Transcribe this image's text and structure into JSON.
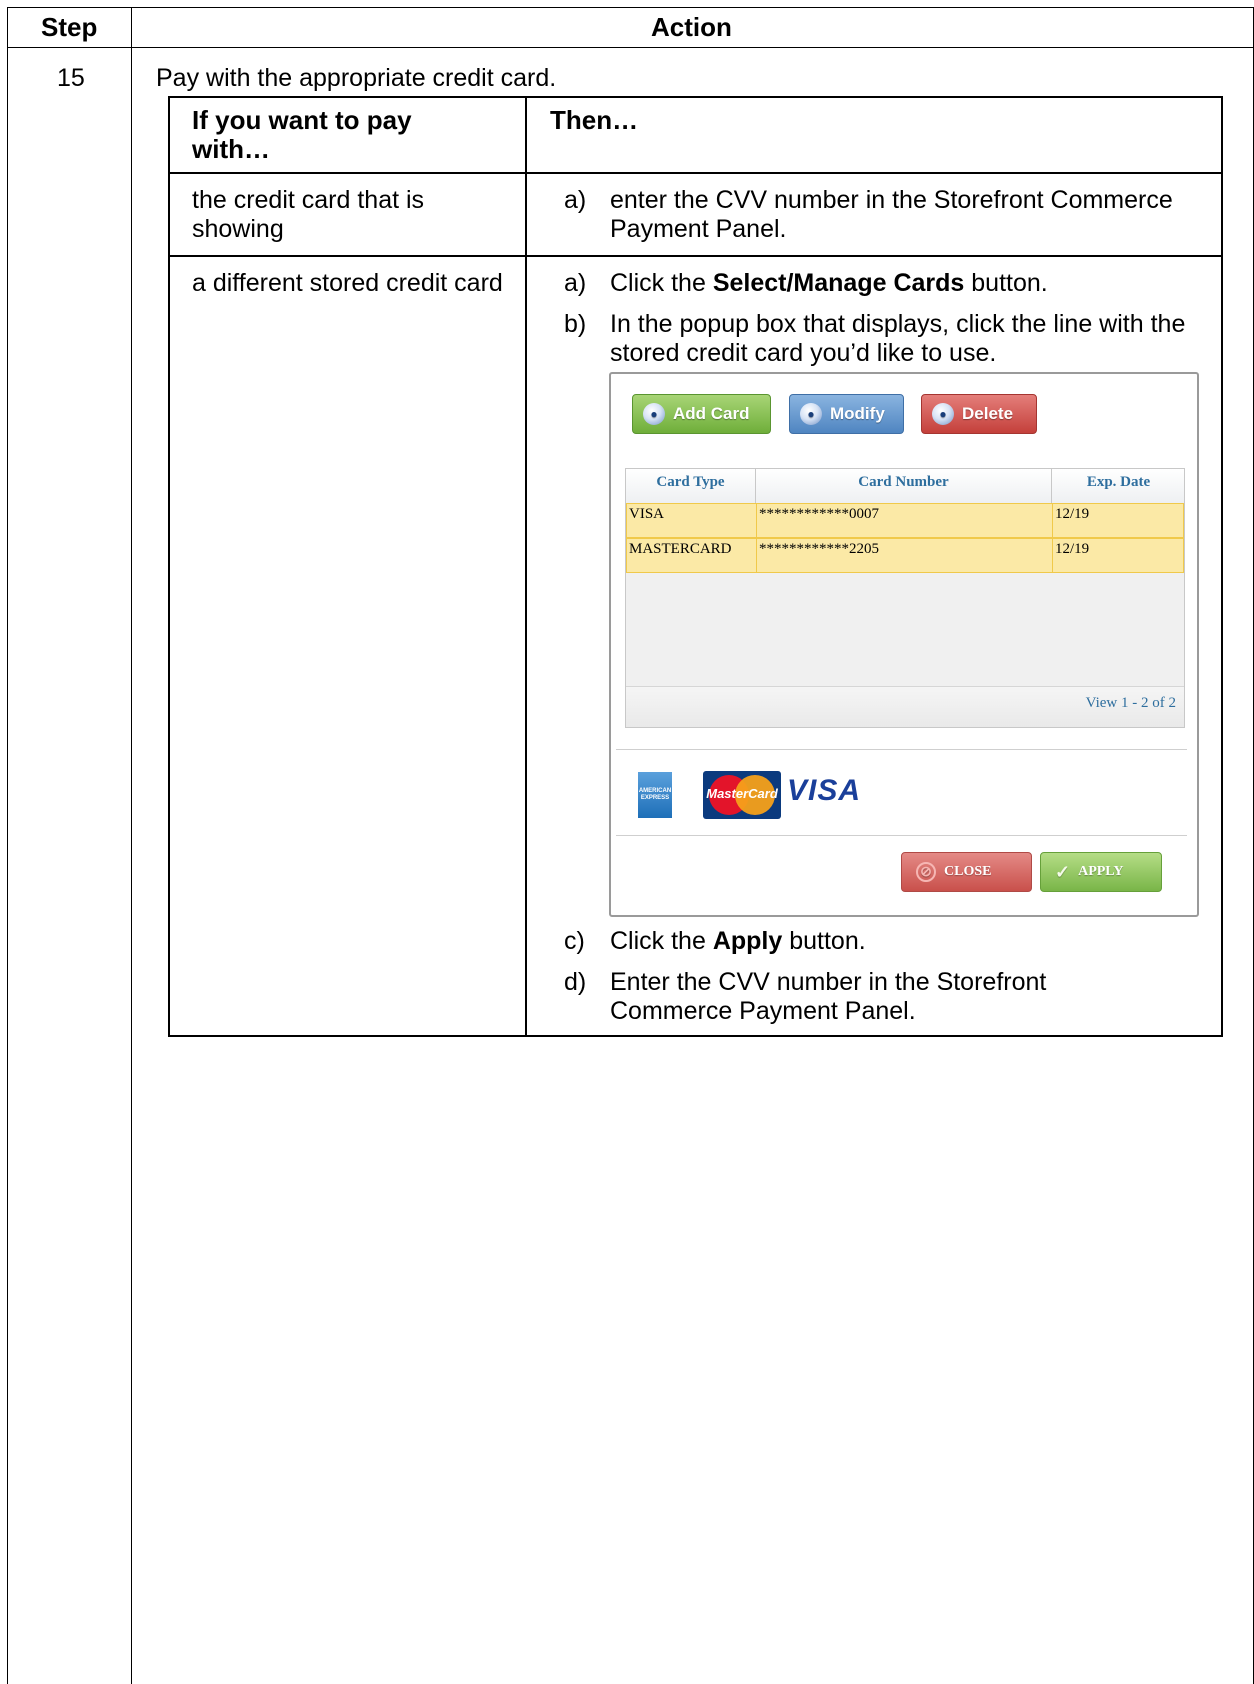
{
  "outer_table": {
    "headers": {
      "step": "Step",
      "action": "Action"
    },
    "step_number": "15",
    "step_text": "Pay with the appropriate credit card."
  },
  "inner_table": {
    "headers": {
      "col1": "If you want to pay with…",
      "col2": "Then…"
    },
    "row1": {
      "condition": "the credit card that is showing",
      "label_a": "a)",
      "text_a": "enter the CVV number in the Storefront Commerce Payment Panel."
    },
    "row2": {
      "condition": "a different stored credit card",
      "a": {
        "label": "a)",
        "pre": "Click the ",
        "bold": "Select/Manage Cards",
        "post": " button."
      },
      "b": {
        "label": "b)",
        "text": "In the popup box that displays, click the line with the stored credit card you’d like to use."
      },
      "c": {
        "label": "c)",
        "pre": "Click the ",
        "bold": "Apply",
        "post": " button."
      },
      "d": {
        "label": "d)",
        "text": "Enter the CVV number in the Storefront Commerce Payment Panel."
      }
    }
  },
  "popup": {
    "buttons": {
      "add": "Add Card",
      "modify": "Modify",
      "delete": "Delete"
    },
    "grid": {
      "columns": [
        "Card Type",
        "Card Number",
        "Exp. Date"
      ],
      "rows": [
        {
          "type": "VISA",
          "number": "************0007",
          "exp": "12/19"
        },
        {
          "type": "MASTERCARD",
          "number": "************2205",
          "exp": "12/19"
        }
      ],
      "footer": "View 1 - 2 of 2"
    },
    "logos": {
      "amex": "AMERICAN EXPRESS",
      "mastercard": "MasterCard",
      "visa": "VISA"
    },
    "actions": {
      "close": "CLOSE",
      "apply": "APPLY"
    }
  }
}
